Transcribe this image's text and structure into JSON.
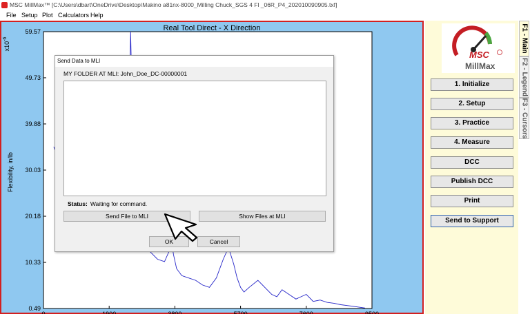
{
  "window": {
    "title": "MSC MillMax™ [C:\\Users\\dbart\\OneDrive\\Desktop\\Makino a81nx-8000_Milling Chuck_SGS 4 Fl _06R_P4_202010090905.txf]"
  },
  "menu": [
    "File",
    "Setup",
    "Plot",
    "Calculators",
    "Help"
  ],
  "chart_data": {
    "type": "line",
    "title": "Real Tool Direct - X Direction",
    "xlabel": "",
    "ylabel": "Flexibility, in/lb",
    "y_multiplier": "x10^-6",
    "ylim": [
      0.49,
      59.57
    ],
    "xlim": [
      0,
      9500
    ],
    "yticks": [
      "59.57",
      "49.73",
      "39.88",
      "30.03",
      "20.18",
      "10.33",
      "0.49"
    ],
    "xticks": [
      "0",
      "1900",
      "3800",
      "5700",
      "7600",
      "9500"
    ],
    "grid": false,
    "series": [
      {
        "color": "#2424c8",
        "x": [
          300,
          500,
          700,
          900,
          1100,
          1300,
          1500,
          1700,
          1900,
          2100,
          2300,
          2400,
          2480,
          2520,
          2580,
          2650,
          2750,
          2900,
          3100,
          3300,
          3500,
          3650,
          3700,
          3760,
          3850,
          4000,
          4200,
          4400,
          4600,
          4800,
          5000,
          5200,
          5350,
          5500,
          5600,
          5700,
          5800,
          5950,
          6200,
          6400,
          6600,
          6750,
          6900,
          7100,
          7300,
          7450,
          7600,
          7800,
          8000,
          8200,
          8400,
          8600,
          8800,
          9000,
          9200,
          9300
        ],
        "y": [
          35,
          30,
          25,
          22,
          20,
          21,
          23,
          26,
          24,
          22,
          26,
          33,
          45,
          60,
          38,
          22,
          16,
          14,
          12.5,
          11,
          10.5,
          13,
          15,
          12,
          9,
          7.5,
          7,
          6.5,
          5.5,
          5,
          7,
          11,
          13.5,
          10,
          7,
          5,
          4,
          5,
          6.5,
          5,
          3.5,
          3,
          4.5,
          3.5,
          2.5,
          3,
          3.5,
          2,
          2.3,
          1.8,
          1.6,
          1.3,
          1.1,
          0.9,
          0.7,
          0.6
        ]
      }
    ]
  },
  "sidebar": {
    "tabs": [
      "F1 - Main",
      "F2 - Legend",
      "F3 - Cursors"
    ],
    "logo_text_top": "MSC",
    "logo_text_bottom": "MillMax",
    "buttons": [
      "1. Initialize",
      "2. Setup",
      "3. Practice",
      "4. Measure",
      "DCC",
      "Publish DCC",
      "Print",
      "Send to Support"
    ]
  },
  "dialog": {
    "title": "Send Data to MLI",
    "folder_label": "MY FOLDER AT MLI: John_Doe_DC-00000001",
    "status_label": "Status:",
    "status_value": "Waiting for command.",
    "send_button": "Send File to MLI",
    "show_button": "Show Files at MLI",
    "ok_button": "OK",
    "cancel_button": "Cancel"
  },
  "colors": {
    "plot_background": "#8fc8f0",
    "plot_border": "#d32020",
    "side_panel": "#fefbd9",
    "series": "#2424c8"
  }
}
